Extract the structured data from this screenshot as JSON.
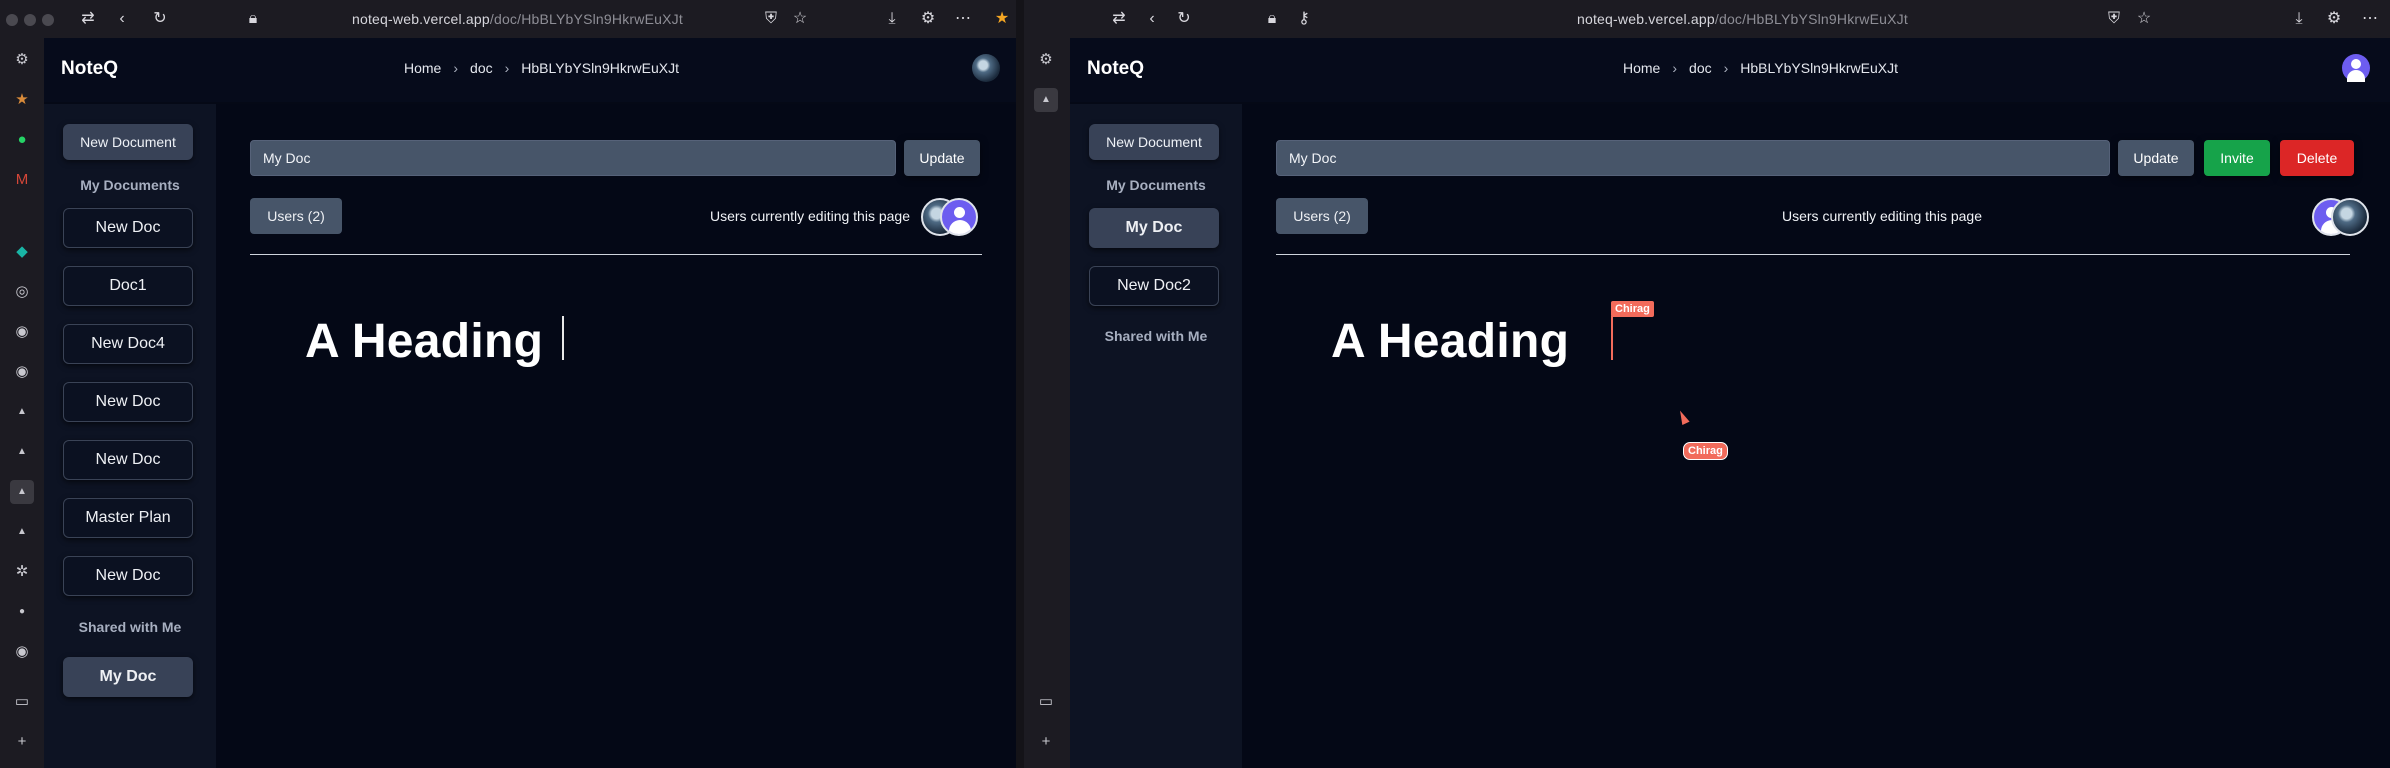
{
  "browser": {
    "left": {
      "url_host": "noteq-web.vercel.app",
      "url_path": "/doc/HbBLYbYSln9HkrwEuXJt"
    },
    "right": {
      "url_host": "noteq-web.vercel.app",
      "url_path": "/doc/HbBLYbYSln9HkrwEuXJt"
    }
  },
  "app": {
    "brand": "NoteQ",
    "breadcrumb": {
      "home": "Home",
      "doc": "doc",
      "id": "HbBLYbYSln9HkrwEuXJt",
      "sep": "›"
    }
  },
  "left": {
    "sidebar": {
      "new_document": "New Document",
      "my_documents_title": "My Documents",
      "my_documents": [
        "New Doc",
        "Doc1",
        "New Doc4",
        "New Doc",
        "New Doc",
        "Master Plan",
        "New Doc"
      ],
      "shared_title": "Shared with Me",
      "shared": [
        "My Doc"
      ]
    },
    "editor": {
      "title_value": "My Doc",
      "update_label": "Update",
      "users_label": "Users (2)",
      "editing_label": "Users currently editing this page",
      "heading": "A Heading"
    }
  },
  "right": {
    "sidebar": {
      "new_document": "New Document",
      "my_documents_title": "My Documents",
      "my_documents": [
        "My Doc",
        "New Doc2"
      ],
      "shared_title": "Shared with Me"
    },
    "editor": {
      "title_value": "My Doc",
      "update_label": "Update",
      "invite_label": "Invite",
      "delete_label": "Delete",
      "users_label": "Users (2)",
      "editing_label": "Users currently editing this page",
      "heading": "A Heading",
      "remote_caret_label": "Chirag",
      "remote_pointer_label": "Chirag"
    }
  },
  "colors": {
    "accent_red": "#f26b5b",
    "invite_green": "#16a34a",
    "delete_red": "#dc2626",
    "slate": "#475569"
  }
}
